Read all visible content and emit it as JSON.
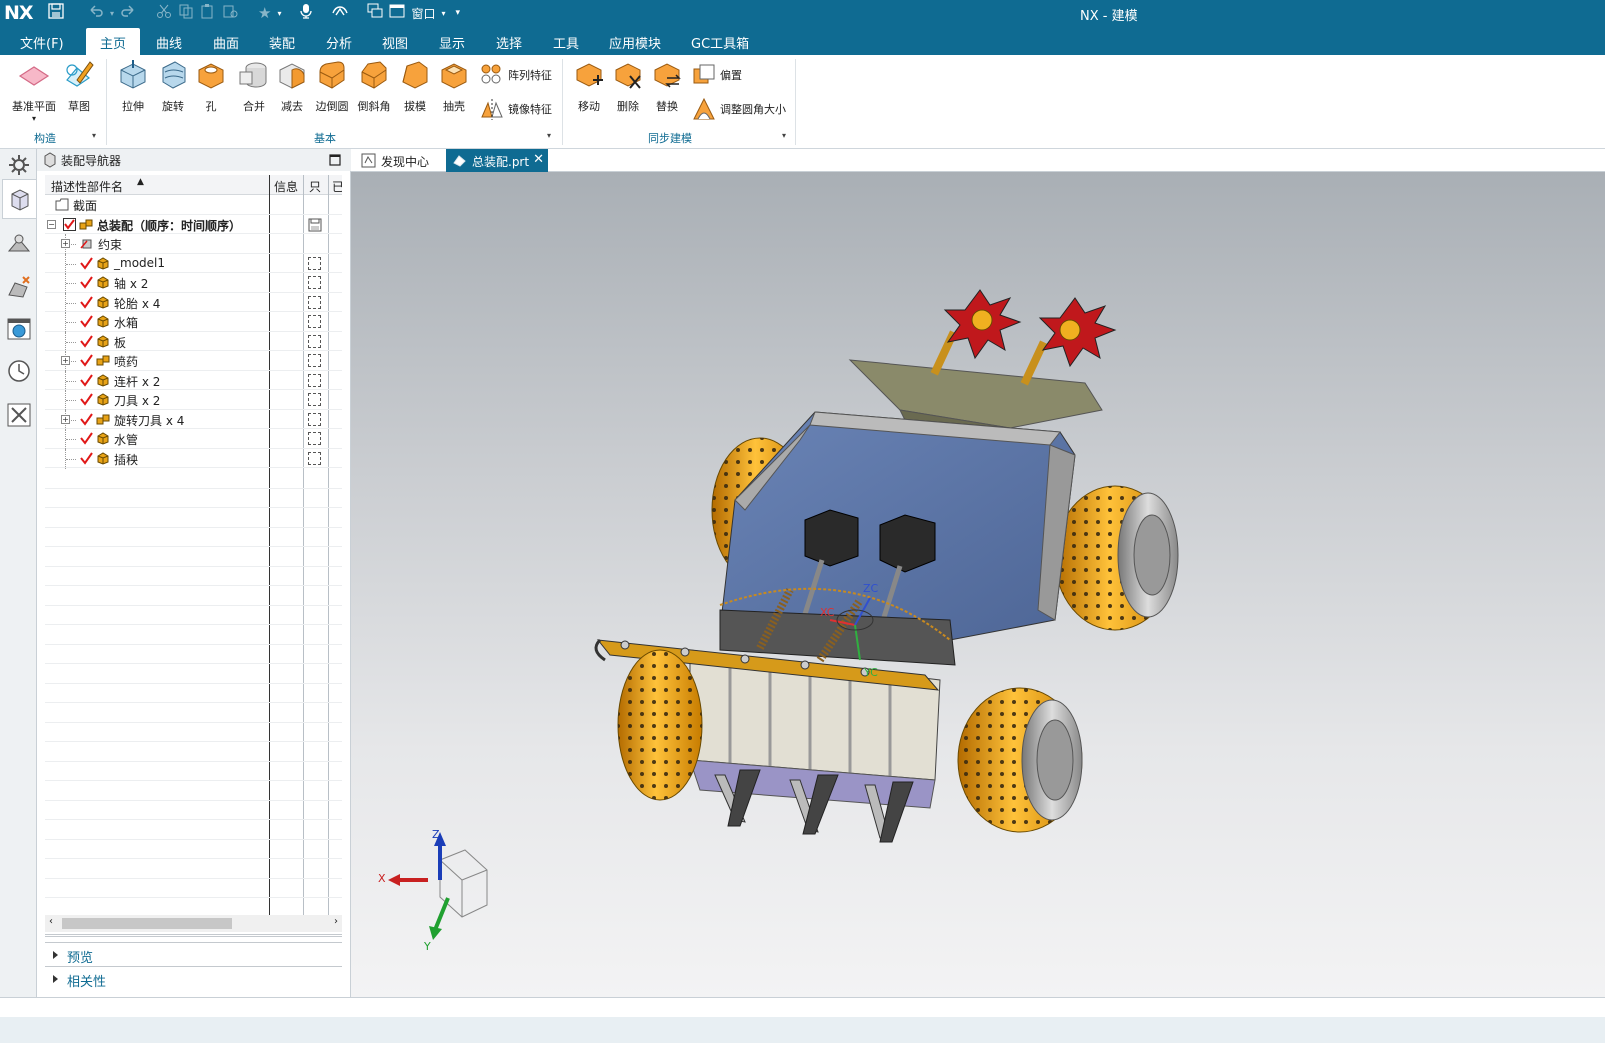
{
  "app": {
    "logo": "NX",
    "window_title": "NX - 建模",
    "quick_access": {
      "window_label": "窗口"
    }
  },
  "menu": [
    "文件(F)",
    "主页",
    "曲线",
    "曲面",
    "装配",
    "分析",
    "视图",
    "显示",
    "选择",
    "工具",
    "应用模块",
    "GC工具箱"
  ],
  "menu_active_index": 1,
  "ribbon": {
    "groups": {
      "construct": {
        "label": "构造",
        "buttons": [
          "基准平面",
          "草图"
        ]
      },
      "basic": {
        "label": "基本",
        "buttons": [
          "拉伸",
          "旋转",
          "孔",
          "合并",
          "减去",
          "边倒圆",
          "倒斜角",
          "拔模",
          "抽壳"
        ],
        "small_buttons": [
          "阵列特征",
          "镜像特征"
        ]
      },
      "sync": {
        "label": "同步建模",
        "buttons": [
          "移动",
          "删除",
          "替换"
        ],
        "small_buttons": [
          "偏置",
          "调整圆角大小"
        ]
      }
    }
  },
  "navigator": {
    "title": "装配导航器",
    "columns": [
      "描述性部件名",
      "信息",
      "只",
      "已"
    ],
    "rows": [
      {
        "name": "截面",
        "indent": 0,
        "type": "folder"
      },
      {
        "name": "总装配（顺序：时间顺序）",
        "indent": 0,
        "type": "assembly-root",
        "bold": true
      },
      {
        "name": "约束",
        "indent": 1,
        "type": "constraint",
        "expandable": true
      },
      {
        "name": "_model1",
        "indent": 1,
        "type": "part"
      },
      {
        "name": "轴 x 2",
        "indent": 1,
        "type": "part"
      },
      {
        "name": "轮胎 x 4",
        "indent": 1,
        "type": "part"
      },
      {
        "name": "水箱",
        "indent": 1,
        "type": "part"
      },
      {
        "name": "板",
        "indent": 1,
        "type": "part"
      },
      {
        "name": "喷药",
        "indent": 1,
        "type": "subassembly",
        "expandable": true
      },
      {
        "name": "连杆 x 2",
        "indent": 1,
        "type": "part"
      },
      {
        "name": "刀具 x 2",
        "indent": 1,
        "type": "part"
      },
      {
        "name": "旋转刀具 x 4",
        "indent": 1,
        "type": "subassembly",
        "expandable": true
      },
      {
        "name": "水管",
        "indent": 1,
        "type": "part"
      },
      {
        "name": "插秧",
        "indent": 1,
        "type": "part"
      }
    ],
    "sections": [
      "预览",
      "相关性"
    ]
  },
  "tabs": [
    {
      "label": "发现中心",
      "icon": "discovery-icon",
      "active": false
    },
    {
      "label": "总装配.prt",
      "icon": "part-file-icon",
      "active": true
    }
  ],
  "viewport": {
    "triad": {
      "x": "X",
      "y": "Y",
      "z": "Z"
    },
    "wcs": {
      "xc": "XC",
      "yc": "YC",
      "zc": "ZC"
    }
  },
  "colors": {
    "accent": "#0f6b92",
    "check": "#e01818",
    "part_yellow": "#e8a317",
    "wheel_orange": "#f0a010",
    "body_blue": "#5f79a8"
  }
}
